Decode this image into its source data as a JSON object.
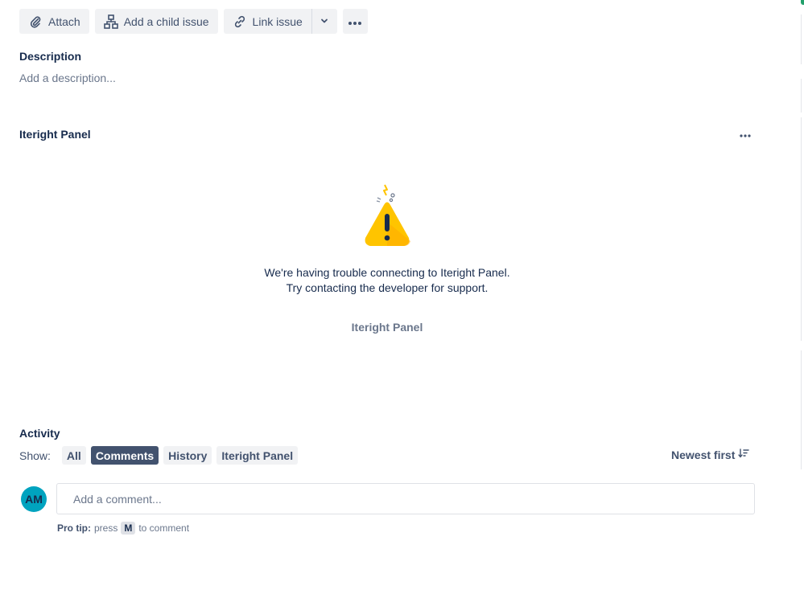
{
  "toolbar": {
    "attach_label": "Attach",
    "add_child_label": "Add a child issue",
    "link_issue_label": "Link issue"
  },
  "description": {
    "title": "Description",
    "placeholder": "Add a description..."
  },
  "panel": {
    "title": "Iteright Panel",
    "error_message": "We're having trouble connecting to Iteright Panel. Try contacting the developer for support.",
    "app_name": "Iteright Panel"
  },
  "activity": {
    "title": "Activity",
    "show_label": "Show:",
    "filters": [
      "All",
      "Comments",
      "History",
      "Iteright Panel"
    ],
    "active_filter": "Comments",
    "sort_label": "Newest first"
  },
  "comment": {
    "avatar_initials": "AM",
    "placeholder": "Add a comment...",
    "protip_label": "Pro tip:",
    "protip_press": "press",
    "protip_key": "M",
    "protip_suffix": "to comment"
  },
  "colors": {
    "button_bg": "#f1f2f4",
    "active_chip_bg": "#42526e",
    "avatar_bg": "#00a3bf",
    "warning_yellow": "#ffc400"
  }
}
